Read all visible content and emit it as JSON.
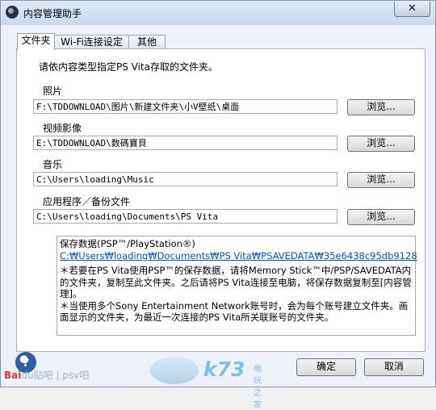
{
  "window": {
    "title": "内容管理助手",
    "close_label": "✕"
  },
  "tabs": [
    "文件夹",
    "Wi-Fi连接设定",
    "其他"
  ],
  "panel": {
    "intro": "请依内容类型指定PS  Vita存取的文件夹。",
    "browse_label": "浏览...",
    "groups": [
      {
        "label": "照片",
        "path": "F:\\TDDOWNLOAD\\图片\\新建文件夹\\小V壁纸\\桌面"
      },
      {
        "label": "视频影像",
        "path": "E:\\TDDOWNLOAD\\数碼寶貝"
      },
      {
        "label": "音乐",
        "path": "C:\\Users\\loading\\Music"
      },
      {
        "label": "应用程序／备份文件",
        "path": "C:\\Users\\loading\\Documents\\PS Vita"
      }
    ],
    "info": {
      "heading": "保存数据(PSP™/PlayStation®)",
      "link": "C:₩Users₩loading₩Documents₩PS Vita₩PSAVEDATA₩35e6438c95db9128",
      "note1": "＊若要在PS  Vita使用PSP™的保存数据，请将Memory Stick™中/PSP/SAVEDATA内的文件夹，复制至此文件夹。之后请将PS  Vita连接至电脑，将保存数据复制至[内容管理]。",
      "note2": "＊当使用多个Sony Entertainment Network账号时，会为每个账号建立文件夹。画面显示的文件夹，为最近一次连接的PS  Vita所关联账号的文件夹。"
    }
  },
  "buttons": {
    "ok": "确定",
    "cancel": "取消"
  },
  "footer": {
    "help_glyph": "?",
    "watermark_baidu_brand": "Bai",
    "watermark_baidu_rest": "du贴吧 | psv吧",
    "watermark_k73": "k73",
    "watermark_k73_sub": "电玩之家"
  }
}
